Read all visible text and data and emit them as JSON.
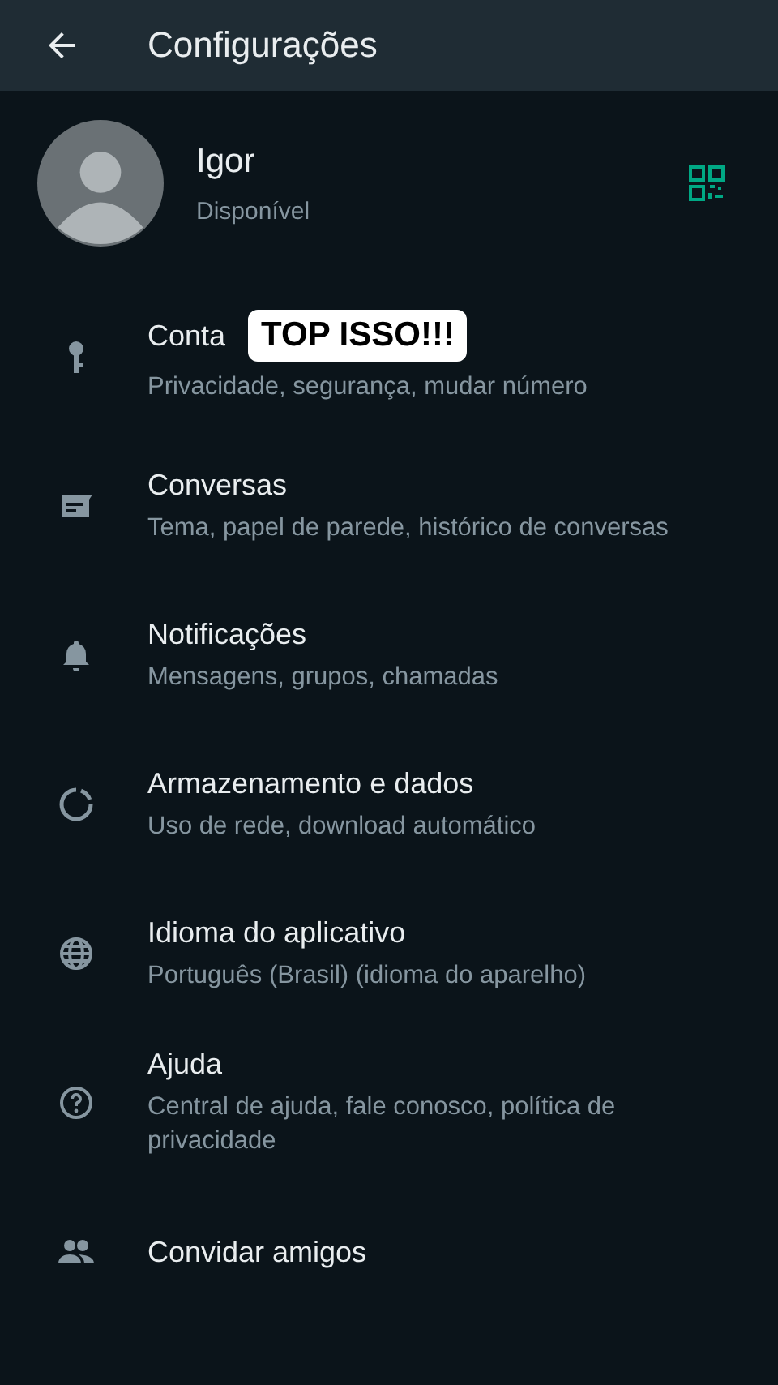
{
  "header": {
    "title": "Configurações"
  },
  "profile": {
    "name": "Igor",
    "status": "Disponível"
  },
  "caption": "TOP ISSO!!!",
  "items": [
    {
      "kind": "key",
      "title": "Conta",
      "subtitle": "Privacidade, segurança, mudar número"
    },
    {
      "kind": "chat",
      "title": "Conversas",
      "subtitle": "Tema, papel de parede, histórico de conversas"
    },
    {
      "kind": "bell",
      "title": "Notificações",
      "subtitle": "Mensagens, grupos, chamadas"
    },
    {
      "kind": "storage",
      "title": "Armazenamento e dados",
      "subtitle": "Uso de rede, download automático"
    },
    {
      "kind": "globe",
      "title": "Idioma do aplicativo",
      "subtitle": "Português (Brasil) (idioma do aparelho)"
    },
    {
      "kind": "help",
      "title": "Ajuda",
      "subtitle": "Central de ajuda, fale conosco, política de privacidade"
    },
    {
      "kind": "people",
      "title": "Convidar amigos"
    }
  ]
}
